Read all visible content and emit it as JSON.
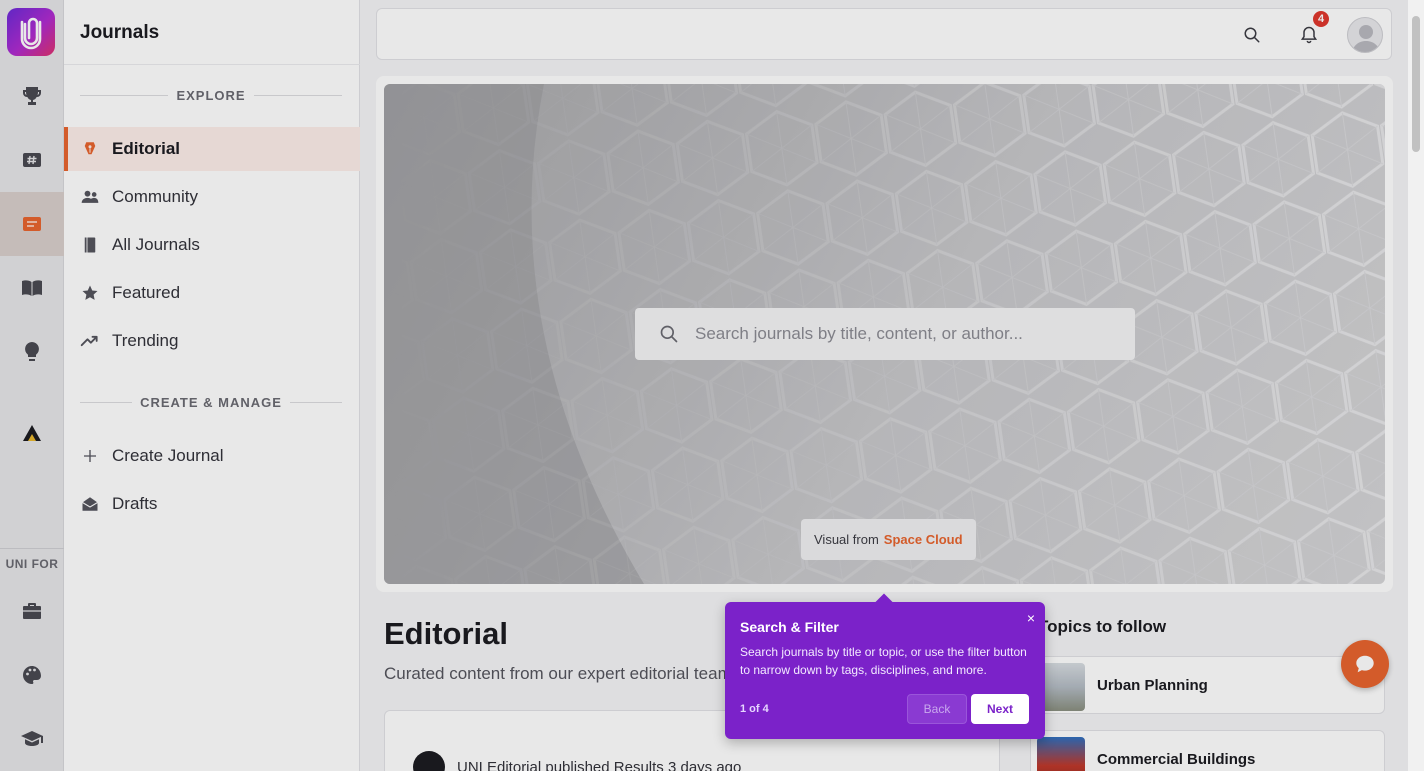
{
  "rail": {
    "items": [
      {
        "icon": "trophy-icon"
      },
      {
        "icon": "hashtag-card-icon"
      },
      {
        "icon": "journal-icon",
        "active": true
      },
      {
        "icon": "book-open-icon"
      },
      {
        "icon": "lightbulb-icon"
      },
      {
        "icon": "triangle-logo-icon"
      }
    ],
    "section_label": "UNI FOR",
    "bottom_items": [
      {
        "icon": "briefcase-icon"
      },
      {
        "icon": "palette-icon"
      },
      {
        "icon": "graduation-cap-icon"
      }
    ]
  },
  "panel": {
    "title": "Journals",
    "explore_heading": "EXPLORE",
    "explore_items": [
      {
        "label": "Editorial",
        "icon": "pen-nib-icon",
        "active": true
      },
      {
        "label": "Community",
        "icon": "people-icon"
      },
      {
        "label": "All Journals",
        "icon": "book-icon"
      },
      {
        "label": "Featured",
        "icon": "star-icon"
      },
      {
        "label": "Trending",
        "icon": "trending-icon"
      }
    ],
    "manage_heading": "CREATE & MANAGE",
    "manage_items": [
      {
        "label": "Create Journal",
        "icon": "plus-icon"
      },
      {
        "label": "Drafts",
        "icon": "envelope-open-icon"
      }
    ]
  },
  "topbar": {
    "notification_count": "4"
  },
  "hero": {
    "search_placeholder": "Search journals by title, content, or author...",
    "credit_prefix": "Visual from",
    "credit_source": "Space Cloud"
  },
  "editorial": {
    "title": "Editorial",
    "subtitle": "Curated content from our expert editorial team",
    "post_author": "UNI Editorial",
    "post_verb": "published",
    "post_title": "Results",
    "post_time": "3 days ago"
  },
  "topics": {
    "title": "Topics to follow",
    "items": [
      {
        "name": "Urban Planning"
      },
      {
        "name": "Commercial Buildings"
      }
    ]
  },
  "tooltip": {
    "title": "Search & Filter",
    "body": "Search journals by title or topic, or use the filter button to narrow down by tags, disciplines, and more.",
    "step": "1 of 4",
    "back_label": "Back",
    "next_label": "Next",
    "close_label": "×"
  },
  "colors": {
    "accent": "#e8652f",
    "tooltip_bg": "#7b22c9",
    "badge": "#e0382e"
  }
}
